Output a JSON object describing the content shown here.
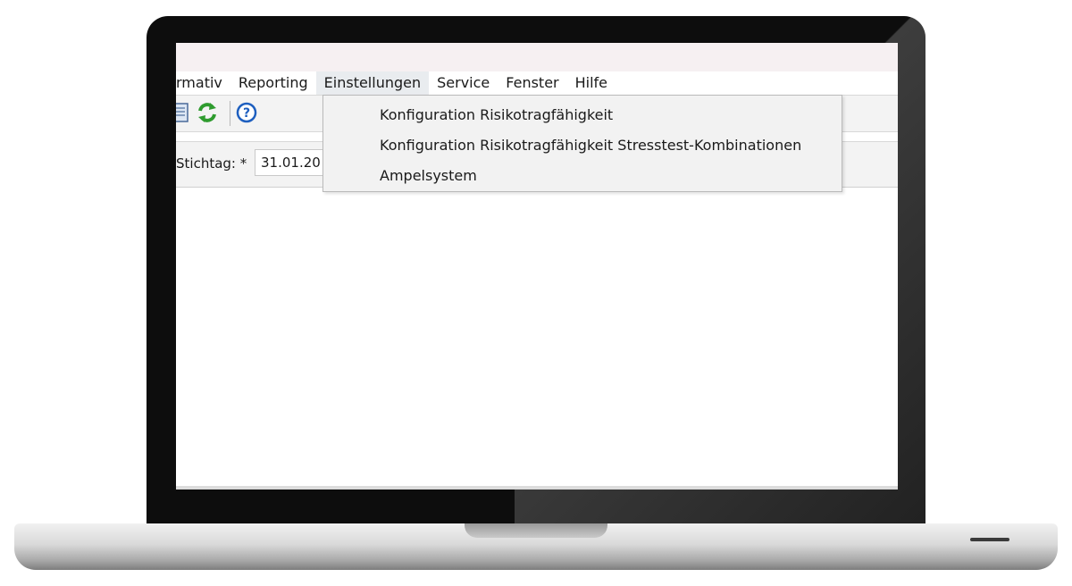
{
  "menubar": {
    "items": [
      {
        "label": "rmativ"
      },
      {
        "label": "Reporting"
      },
      {
        "label": "Einstellungen"
      },
      {
        "label": "Service"
      },
      {
        "label": "Fenster"
      },
      {
        "label": "Hilfe"
      }
    ],
    "open_menu": "Einstellungen"
  },
  "toolbar": {
    "icons": [
      "document-icon",
      "refresh-icon",
      "help-icon"
    ]
  },
  "filter": {
    "stichtag_label": "Stichtag: *",
    "stichtag_value": "31.01.20"
  },
  "dropdown": {
    "items": [
      {
        "label": "Konfiguration Risikotragfähigkeit"
      },
      {
        "label": "Konfiguration Risikotragfähigkeit Stresstest-Kombinationen"
      },
      {
        "label": "Ampelsystem"
      }
    ]
  },
  "colors": {
    "bezel": "#0d0d0d",
    "titlebar": "#f6f0f2",
    "toolbar": "#f3f3f3",
    "refresh_icon": "#2e9b2e",
    "help_icon": "#1e5fbf"
  }
}
